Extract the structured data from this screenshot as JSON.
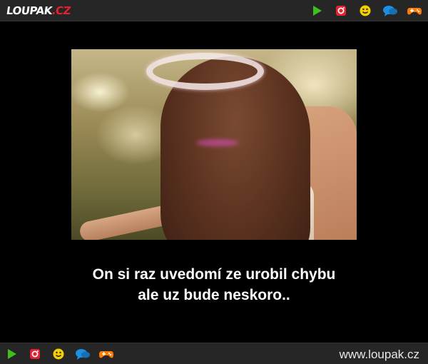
{
  "header": {
    "logo_main": "LOUPAK",
    "logo_suffix": ".CZ",
    "icons": [
      "play-icon",
      "instagram-icon",
      "smiley-icon",
      "chat-icon",
      "gamepad-icon"
    ]
  },
  "post": {
    "caption_line1": "On si raz uvedomí ze urobil chybu",
    "caption_line2": "ale uz bude neskoro.."
  },
  "footer": {
    "icons": [
      "play-icon",
      "instagram-icon",
      "smiley-icon",
      "chat-icon",
      "gamepad-icon"
    ],
    "url": "www.loupak.cz"
  },
  "colors": {
    "bar_background": "#262626",
    "page_background": "#000000",
    "play": "#3fbf1f",
    "instagram": "#e8212e",
    "smiley": "#f5d000",
    "chat": "#1e8fe0",
    "gamepad": "#ff7a00"
  }
}
